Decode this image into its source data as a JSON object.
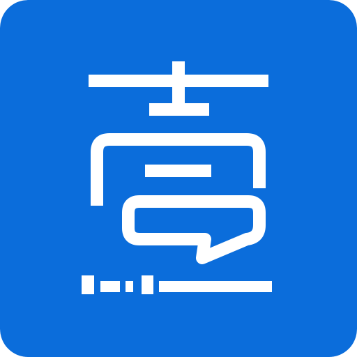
{
  "icon": {
    "name": "yi-character-app-icon",
    "background_color": "#0B6DDB",
    "glyph_color": "#FFFFFF"
  }
}
